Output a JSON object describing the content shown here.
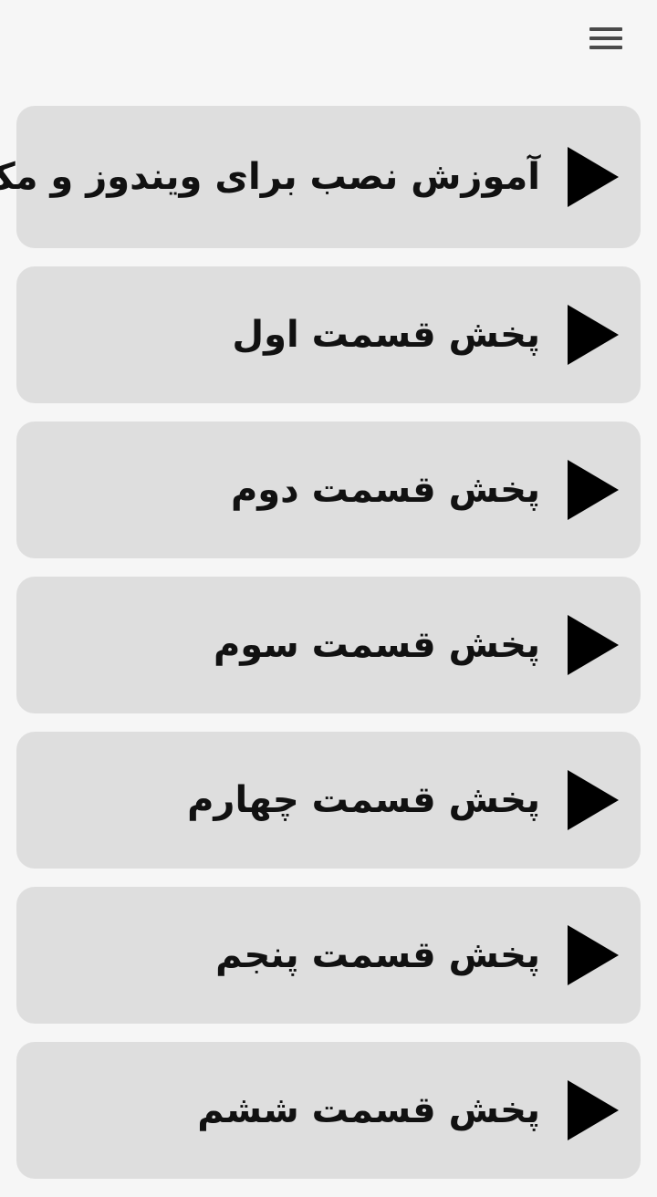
{
  "header": {
    "menu_icon": "hamburger-menu-icon"
  },
  "items": [
    {
      "label": "آموزش نصب  برای ویندوز و مک",
      "icon": "play-icon"
    },
    {
      "label": "پخش قسمت اول",
      "icon": "play-icon"
    },
    {
      "label": "پخش قسمت دوم",
      "icon": "play-icon"
    },
    {
      "label": "پخش قسمت سوم",
      "icon": "play-icon"
    },
    {
      "label": "پخش قسمت چهارم",
      "icon": "play-icon"
    },
    {
      "label": "پخش قسمت پنجم",
      "icon": "play-icon"
    },
    {
      "label": "پخش قسمت ششم",
      "icon": "play-icon"
    }
  ],
  "colors": {
    "background": "#f6f6f6",
    "card": "#dedede",
    "text": "#111111",
    "icon": "#000000",
    "menu_icon": "#4a4a4a"
  }
}
